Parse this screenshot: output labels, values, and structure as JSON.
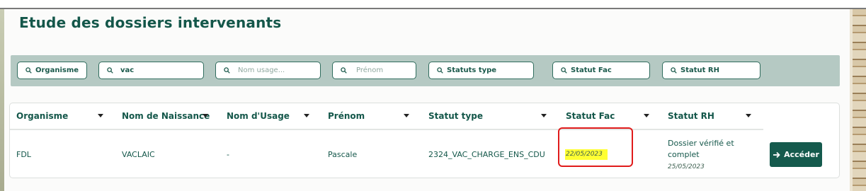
{
  "page": {
    "title": "Etude des dossiers intervenants"
  },
  "filters": [
    {
      "label": "Organisme",
      "value": "",
      "placeholder": ""
    },
    {
      "label": "",
      "value": "vac",
      "placeholder": ""
    },
    {
      "label": "",
      "value": "",
      "placeholder": "Nom usage..."
    },
    {
      "label": "",
      "value": "",
      "placeholder": "Prénom"
    },
    {
      "label": "Statuts type",
      "value": "",
      "placeholder": ""
    },
    {
      "label": "Statut Fac",
      "value": "",
      "placeholder": ""
    },
    {
      "label": "Statut RH",
      "value": "",
      "placeholder": ""
    }
  ],
  "table": {
    "columns": [
      "Organisme",
      "Nom de Naissance",
      "Nom d'Usage",
      "Prénom",
      "Statut type",
      "Statut Fac",
      "Statut RH"
    ],
    "rows": [
      {
        "organisme": "FDL",
        "nom_naissance": "VACLAIC",
        "nom_usage": "-",
        "prenom": "Pascale",
        "statut_type": "2324_VAC_CHARGE_ENS_CDU",
        "statut_fac_date": "22/05/2023",
        "statut_rh": "Dossier vérifié et complet",
        "statut_rh_date": "25/05/2023",
        "action": "Accéder"
      }
    ]
  },
  "colors": {
    "primary": "#155a4d",
    "filter_bar": "#b5c9c3",
    "highlight": "#ffff33",
    "annotation": "#e01b1b"
  }
}
